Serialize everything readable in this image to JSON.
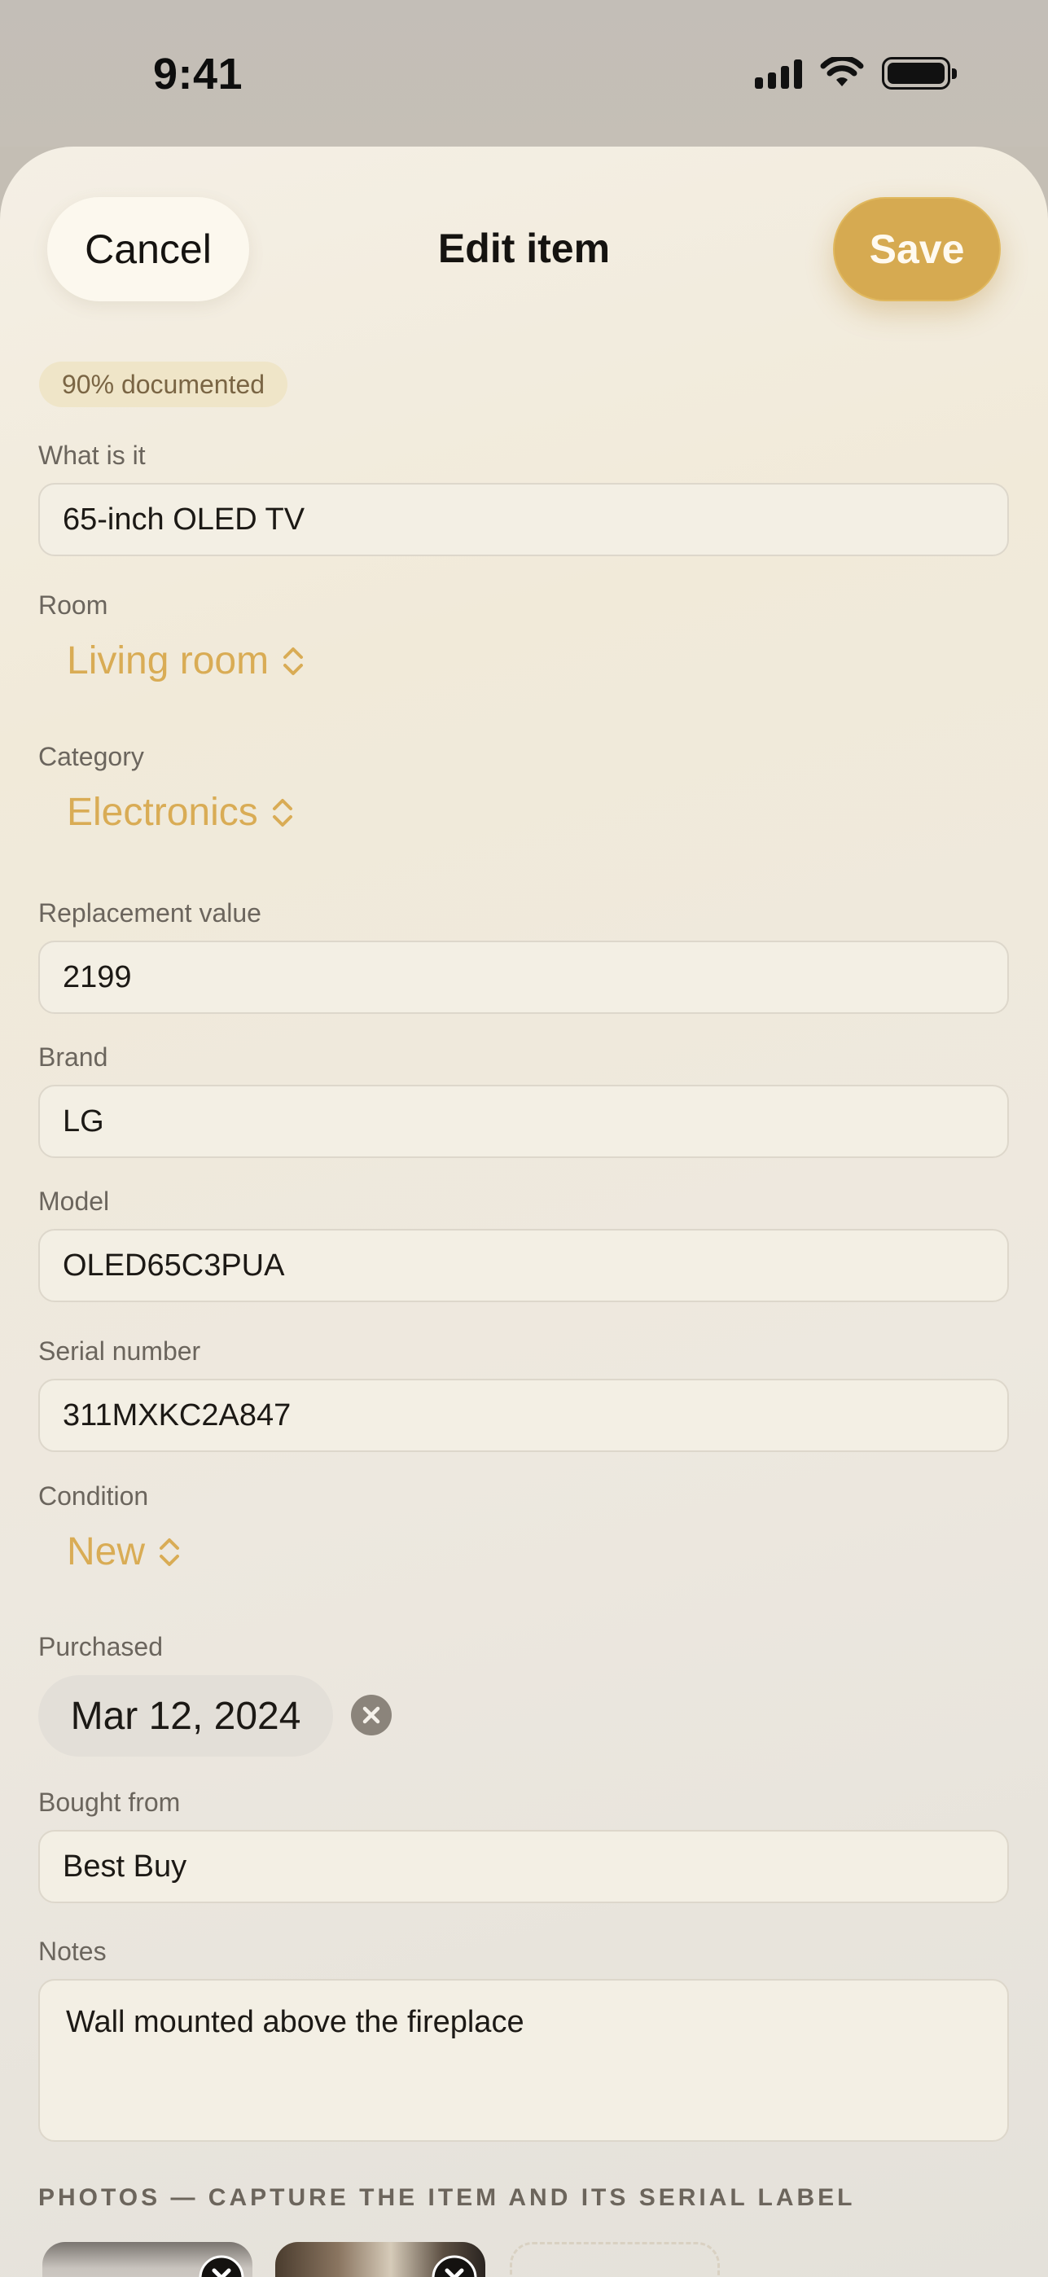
{
  "status_bar": {
    "time": "9:41"
  },
  "nav": {
    "cancel": "Cancel",
    "title": "Edit item",
    "save": "Save"
  },
  "badge": "90% documented",
  "form": {
    "what": {
      "label": "What is it",
      "value": "65-inch OLED TV"
    },
    "room": {
      "label": "Room",
      "value": "Living room"
    },
    "category": {
      "label": "Category",
      "value": "Electronics"
    },
    "value": {
      "label": "Replacement value",
      "value": "2199"
    },
    "brand": {
      "label": "Brand",
      "value": "LG"
    },
    "model": {
      "label": "Model",
      "value": "OLED65C3PUA"
    },
    "serial": {
      "label": "Serial number",
      "value": "311MXKC2A847"
    },
    "condition": {
      "label": "Condition",
      "value": "New"
    },
    "purchased": {
      "label": "Purchased",
      "value": "Mar 12, 2024"
    },
    "bought_from": {
      "label": "Bought from",
      "value": "Best Buy"
    },
    "notes": {
      "label": "Notes",
      "value": "Wall mounted above the fireplace"
    }
  },
  "photos": {
    "header": "PHOTOS — CAPTURE THE ITEM AND ITS SERIAL LABEL",
    "count": 2
  },
  "colors": {
    "accent": "#d6aa51",
    "picker_text": "#d9ac55",
    "badge_bg": "#efe5c8"
  }
}
